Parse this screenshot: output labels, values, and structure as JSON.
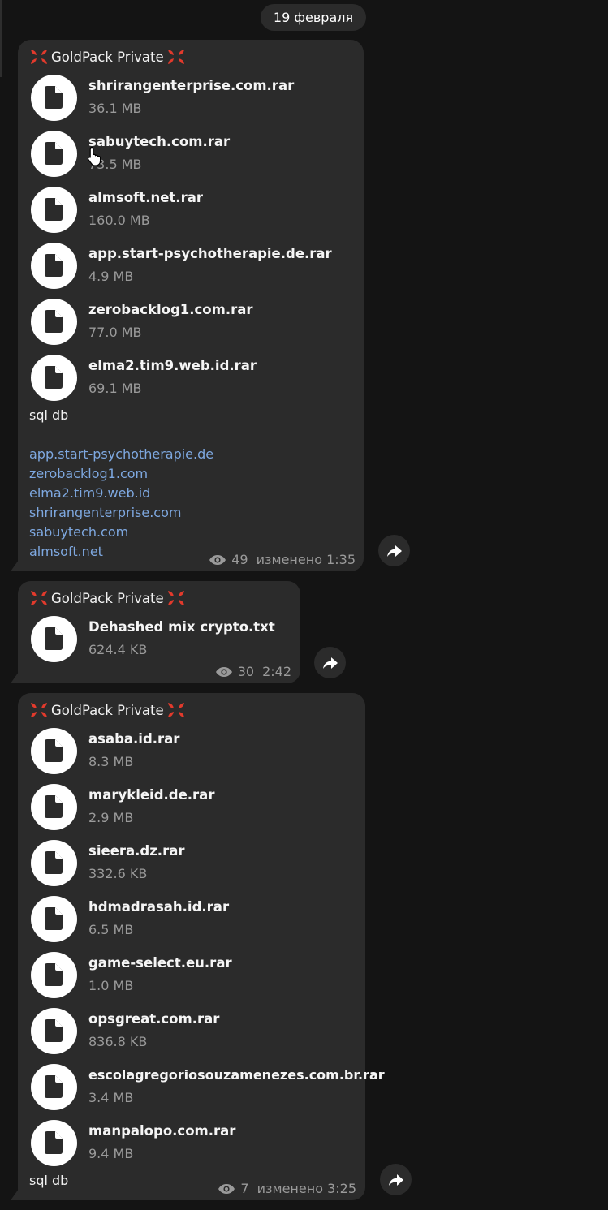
{
  "date_separator": "19 февраля",
  "messages": [
    {
      "sender": "GoldPack Private",
      "files": [
        {
          "name": "shrirangenterprise.com.rar",
          "size": "36.1 MB"
        },
        {
          "name": "sabuytech.com.rar",
          "size": "73.5 MB"
        },
        {
          "name": "almsoft.net.rar",
          "size": "160.0 MB"
        },
        {
          "name": "app.start-psychotherapie.de.rar",
          "size": "4.9 MB"
        },
        {
          "name": "zerobacklog1.com.rar",
          "size": "77.0 MB"
        },
        {
          "name": "elma2.tim9.web.id.rar",
          "size": "69.1 MB"
        }
      ],
      "caption": "sql db",
      "links": [
        "app.start-psychotherapie.de",
        "zerobacklog1.com",
        "elma2.tim9.web.id",
        "shrirangenterprise.com",
        "sabuytech.com",
        "almsoft.net"
      ],
      "views": "49",
      "time": "изменено 1:35"
    },
    {
      "sender": "GoldPack Private",
      "files": [
        {
          "name": "Dehashed mix crypto.txt",
          "size": "624.4 KB"
        }
      ],
      "views": "30",
      "time": "2:42"
    },
    {
      "sender": "GoldPack Private",
      "files": [
        {
          "name": "asaba.id.rar",
          "size": "8.3 MB"
        },
        {
          "name": "marykleid.de.rar",
          "size": "2.9 MB"
        },
        {
          "name": "sieera.dz.rar",
          "size": "332.6 KB"
        },
        {
          "name": "hdmadrasah.id.rar",
          "size": "6.5 MB"
        },
        {
          "name": "game-select.eu.rar",
          "size": "1.0 MB"
        },
        {
          "name": "opsgreat.com.rar",
          "size": "836.8 KB"
        },
        {
          "name": "escolagregoriosouzamenezes.com.br.rar",
          "size": "3.4 MB"
        },
        {
          "name": "manpalopo.com.rar",
          "size": "9.4 MB"
        }
      ],
      "caption": "sql db",
      "views": "7",
      "time": "изменено 3:25"
    }
  ],
  "icons": {
    "sender_emoji": "anger-symbol-icon",
    "file": "file-document-icon",
    "views": "eye-icon",
    "forward": "forward-arrow-icon"
  },
  "colors": {
    "background": "#141414",
    "bubble": "#2b2b2b",
    "link": "#7ea8e0",
    "meta": "#9a9a9a",
    "anger_emoji": "#e23a2c"
  }
}
